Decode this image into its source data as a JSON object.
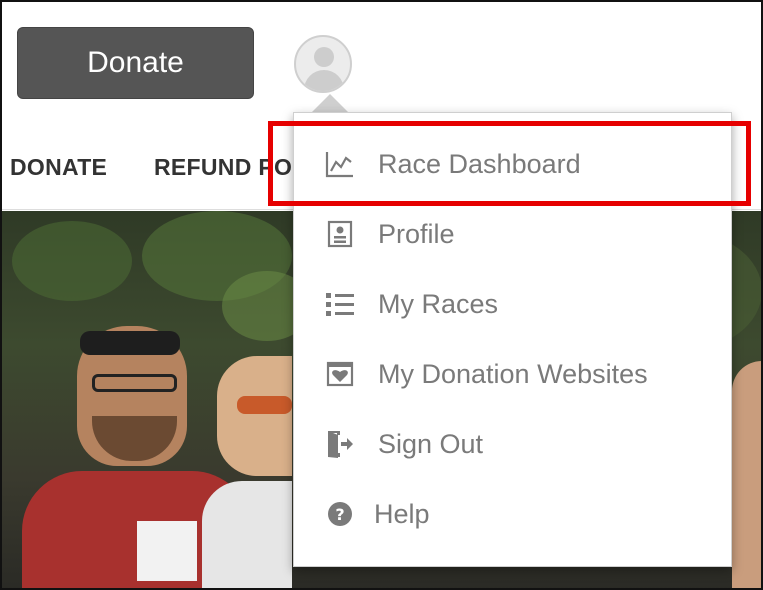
{
  "header": {
    "donate_button": "Donate"
  },
  "nav": {
    "items": [
      {
        "label": "DONATE"
      },
      {
        "label": "REFUND POLICY"
      }
    ]
  },
  "user_menu": {
    "items": [
      {
        "label": "Race Dashboard",
        "icon": "chart-line-icon"
      },
      {
        "label": "Profile",
        "icon": "profile-card-icon"
      },
      {
        "label": "My Races",
        "icon": "list-icon"
      },
      {
        "label": "My Donation Websites",
        "icon": "heart-card-icon"
      },
      {
        "label": "Sign Out",
        "icon": "sign-out-icon"
      },
      {
        "label": "Help",
        "icon": "help-circle-icon"
      }
    ],
    "highlighted_index": 0,
    "highlight_color": "#e60000"
  },
  "colors": {
    "donate_button_bg": "#555555",
    "menu_text": "#7a7a7a"
  }
}
